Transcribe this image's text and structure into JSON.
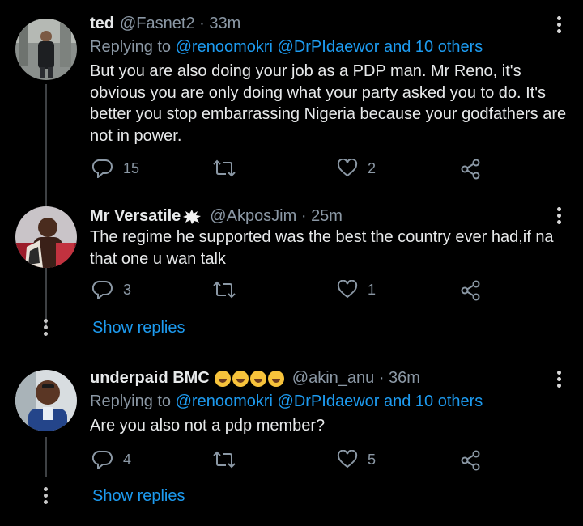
{
  "tweets": [
    {
      "name": "ted",
      "handle": "@Fasnet2 · 33m",
      "replying_prefix": "Replying to ",
      "replying_targets": "@renoomokri @DrPIdaewor and 10 others",
      "text": "But you are also doing your job as a PDP man.  Mr Reno, it's obvious you are only doing what  your party asked you to do. It's better you stop embarrassing Nigeria because your godfathers are not in power.",
      "replies": "15",
      "retweets": "",
      "likes": "2"
    },
    {
      "name": "Mr Versatile",
      "handle": "@AkposJim · 25m",
      "text": "The regime he supported was the best the country ever had,if na that one u wan talk",
      "replies": "3",
      "retweets": "",
      "likes": "1",
      "show_replies": "Show replies"
    },
    {
      "name": "underpaid BMC",
      "handle": "@akin_anu · 36m",
      "replying_prefix": "Replying to ",
      "replying_targets": "@renoomokri @DrPIdaewor and 10 others",
      "text": "Are you also not a pdp member?",
      "replies": "4",
      "retweets": "",
      "likes": "5",
      "show_replies": "Show replies"
    }
  ],
  "colors": {
    "accent": "#1d9bf0",
    "muted": "#8b98a5",
    "text": "#e7e9ea",
    "background": "#000000"
  },
  "icons": [
    "reply-icon",
    "retweet-icon",
    "like-icon",
    "share-icon",
    "more-icon",
    "verified-splash-icon",
    "rofl-emoji"
  ]
}
